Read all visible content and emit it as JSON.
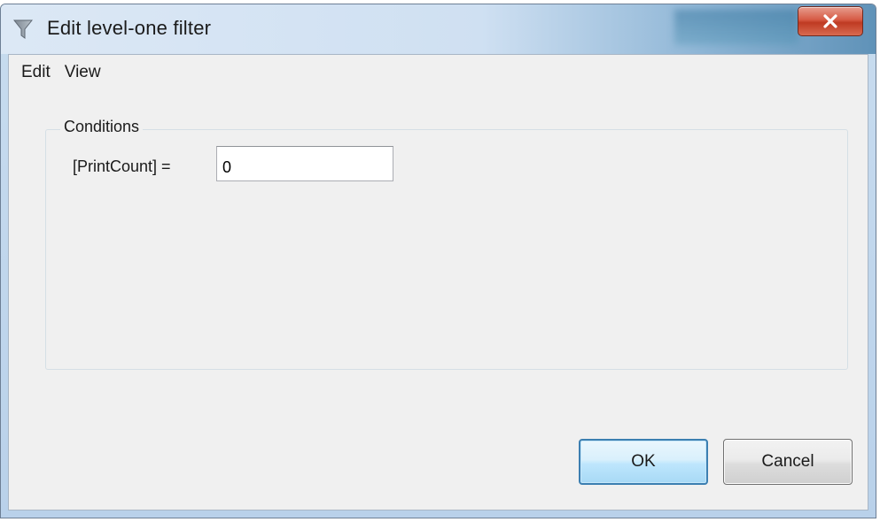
{
  "window": {
    "title": "Edit level-one filter",
    "close_icon": "close-icon"
  },
  "menu": {
    "items": [
      "Edit",
      "View"
    ]
  },
  "conditions": {
    "group_label": "Conditions",
    "field_label": "[PrintCount] =",
    "field_value": "0"
  },
  "buttons": {
    "ok_label": "OK",
    "cancel_label": "Cancel"
  },
  "colors": {
    "titlebar_accent": "#5f92b8",
    "close_button": "#d65a44",
    "client_background": "#f0f0f0",
    "default_button_border": "#3c7fb1"
  }
}
